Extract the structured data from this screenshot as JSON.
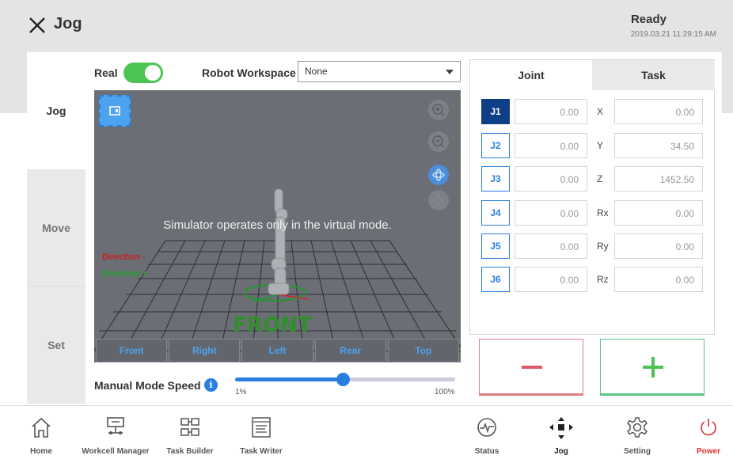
{
  "header": {
    "title": "Jog",
    "status": "Ready",
    "datetime": "2019.03.21 11:29:15 AM"
  },
  "side_tabs": [
    {
      "label": "Jog",
      "active": true
    },
    {
      "label": "Move",
      "active": false
    },
    {
      "label": "Set",
      "active": false
    }
  ],
  "controls": {
    "real_label": "Real",
    "real_on": true,
    "workspace_label": "Robot Workspace",
    "workspace_value": "None"
  },
  "viewport": {
    "message": "Simulator operates only in the virtual mode.",
    "direction_minus": "Direction -",
    "direction_plus": "Direction +",
    "floor_text": "FRONT",
    "view_buttons": [
      "Front",
      "Right",
      "Left",
      "Rear",
      "Top"
    ]
  },
  "speed": {
    "label": "Manual Mode Speed",
    "min_label": "1%",
    "max_label": "100%",
    "value_fraction": 0.49
  },
  "panel": {
    "tabs": [
      "Joint",
      "Task"
    ],
    "active_tab": "Joint",
    "joints": [
      {
        "name": "J1",
        "value": "0.00",
        "selected": true
      },
      {
        "name": "J2",
        "value": "0.00",
        "selected": false
      },
      {
        "name": "J3",
        "value": "0.00",
        "selected": false
      },
      {
        "name": "J4",
        "value": "0.00",
        "selected": false
      },
      {
        "name": "J5",
        "value": "0.00",
        "selected": false
      },
      {
        "name": "J6",
        "value": "0.00",
        "selected": false
      }
    ],
    "task": [
      {
        "name": "X",
        "value": "0.00"
      },
      {
        "name": "Y",
        "value": "34.50"
      },
      {
        "name": "Z",
        "value": "1452.50"
      },
      {
        "name": "Rx",
        "value": "0.00"
      },
      {
        "name": "Ry",
        "value": "0.00"
      },
      {
        "name": "Rz",
        "value": "0.00"
      }
    ]
  },
  "colors": {
    "accent": "#2a7de1",
    "toggle_on": "#4cc454",
    "minus": "#e05a6a",
    "plus": "#4cc454",
    "power": "#e03030"
  },
  "nav": [
    {
      "label": "Home",
      "icon": "home-icon"
    },
    {
      "label": "Workcell Manager",
      "icon": "workcell-manager-icon"
    },
    {
      "label": "Task Builder",
      "icon": "task-builder-icon"
    },
    {
      "label": "Task Writer",
      "icon": "task-writer-icon"
    },
    {
      "label": "Status",
      "icon": "status-icon"
    },
    {
      "label": "Jog",
      "icon": "jog-icon"
    },
    {
      "label": "Setting",
      "icon": "gear-icon"
    },
    {
      "label": "Power",
      "icon": "power-icon"
    }
  ]
}
